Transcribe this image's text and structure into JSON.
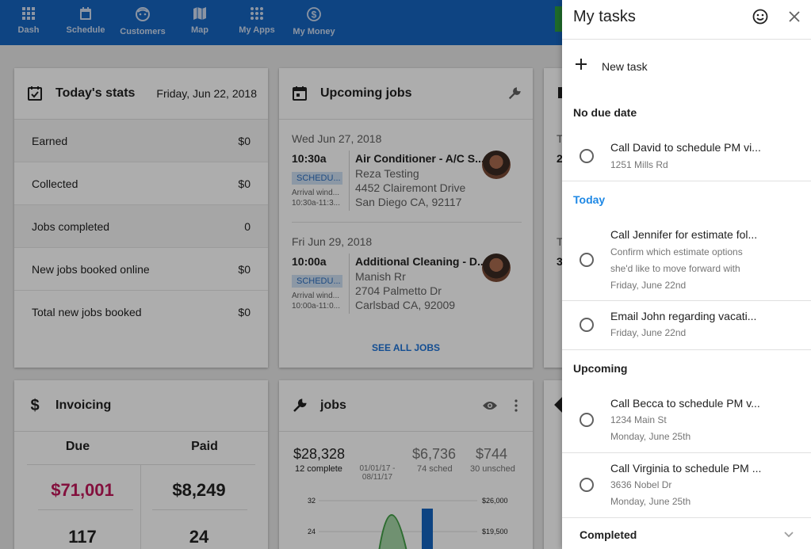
{
  "nav": {
    "items": [
      {
        "label": "Dash",
        "icon": "dashboard-icon"
      },
      {
        "label": "Schedule",
        "icon": "calendar-icon"
      },
      {
        "label": "Customers",
        "icon": "face-icon"
      },
      {
        "label": "Map",
        "icon": "map-icon"
      },
      {
        "label": "My Apps",
        "icon": "apps-icon"
      },
      {
        "label": "My Money",
        "icon": "dollar-icon"
      }
    ]
  },
  "stats": {
    "title": "Today's stats",
    "date": "Friday, Jun 22, 2018",
    "rows": [
      {
        "label": "Earned",
        "value": "$0"
      },
      {
        "label": "Collected",
        "value": "$0"
      },
      {
        "label": "Jobs completed",
        "value": "0"
      },
      {
        "label": "New jobs booked online",
        "value": "$0"
      },
      {
        "label": "Total new jobs booked",
        "value": "$0"
      }
    ]
  },
  "upcoming": {
    "title": "Upcoming jobs",
    "see_all": "SEE ALL JOBS",
    "jobs": [
      {
        "date": "Wed Jun 27, 2018",
        "time": "10:30a",
        "badge": "SCHEDU...",
        "arrival1": "Arrival wind...",
        "arrival2": "10:30a-11:3...",
        "name": "Air Conditioner - A/C S...",
        "customer": "Reza Testing",
        "street": "4452 Clairemont Drive",
        "city": "San Diego CA, 92117"
      },
      {
        "date": "Fri Jun 29, 2018",
        "time": "10:00a",
        "badge": "SCHEDU...",
        "arrival1": "Arrival wind...",
        "arrival2": "10:00a-11:0...",
        "name": "Additional Cleaning - D...",
        "customer": "Manish Rr",
        "street": "2704 Palmetto Dr",
        "city": "Carlsbad CA, 92009"
      }
    ]
  },
  "invoicing": {
    "title": "Invoicing",
    "due_label": "Due",
    "paid_label": "Paid",
    "due_amount": "$71,001",
    "paid_amount": "$8,249",
    "due_count": "117",
    "paid_count": "24",
    "due_color": "#c2185b"
  },
  "jobs_card": {
    "title": "jobs",
    "total": "$28,328",
    "total_sub": "12 complete",
    "range1": "01/01/17 -",
    "range2": "08/11/17",
    "sched": "$6,736",
    "sched_sub": "74 sched",
    "unsched": "$744",
    "unsched_sub": "30 unsched",
    "y_left": [
      "32",
      "24"
    ],
    "y_right": [
      "$26,000",
      "$19,500"
    ]
  },
  "third_col": {
    "letters": [
      "T",
      "2",
      "T",
      "3"
    ]
  },
  "tasks": {
    "title": "My tasks",
    "new_task": "New task",
    "sections": {
      "no_due": "No due date",
      "today": "Today",
      "upcoming": "Upcoming",
      "completed": "Completed"
    },
    "items": [
      {
        "title": "Call David to schedule PM vi...",
        "sub1": "1251 Mills Rd",
        "sub2": "",
        "sub3": ""
      },
      {
        "title": "Call Jennifer for estimate fol...",
        "sub1": "Confirm which estimate options",
        "sub2": "she'd like to move forward with",
        "sub3": "Friday, June 22nd"
      },
      {
        "title": "Email John regarding vacati...",
        "sub1": "Friday, June 22nd",
        "sub2": "",
        "sub3": ""
      },
      {
        "title": "Call Becca to schedule PM v...",
        "sub1": "1234 Main St",
        "sub2": "Monday, June 25th",
        "sub3": ""
      },
      {
        "title": "Call Virginia to schedule PM ...",
        "sub1": "3636 Nobel Dr",
        "sub2": "Monday, June 25th",
        "sub3": ""
      }
    ]
  },
  "colors": {
    "nav_bg": "#1565c0",
    "accent": "#1e88e5",
    "chart_green": "#43a047",
    "chart_blue": "#1565c0"
  }
}
